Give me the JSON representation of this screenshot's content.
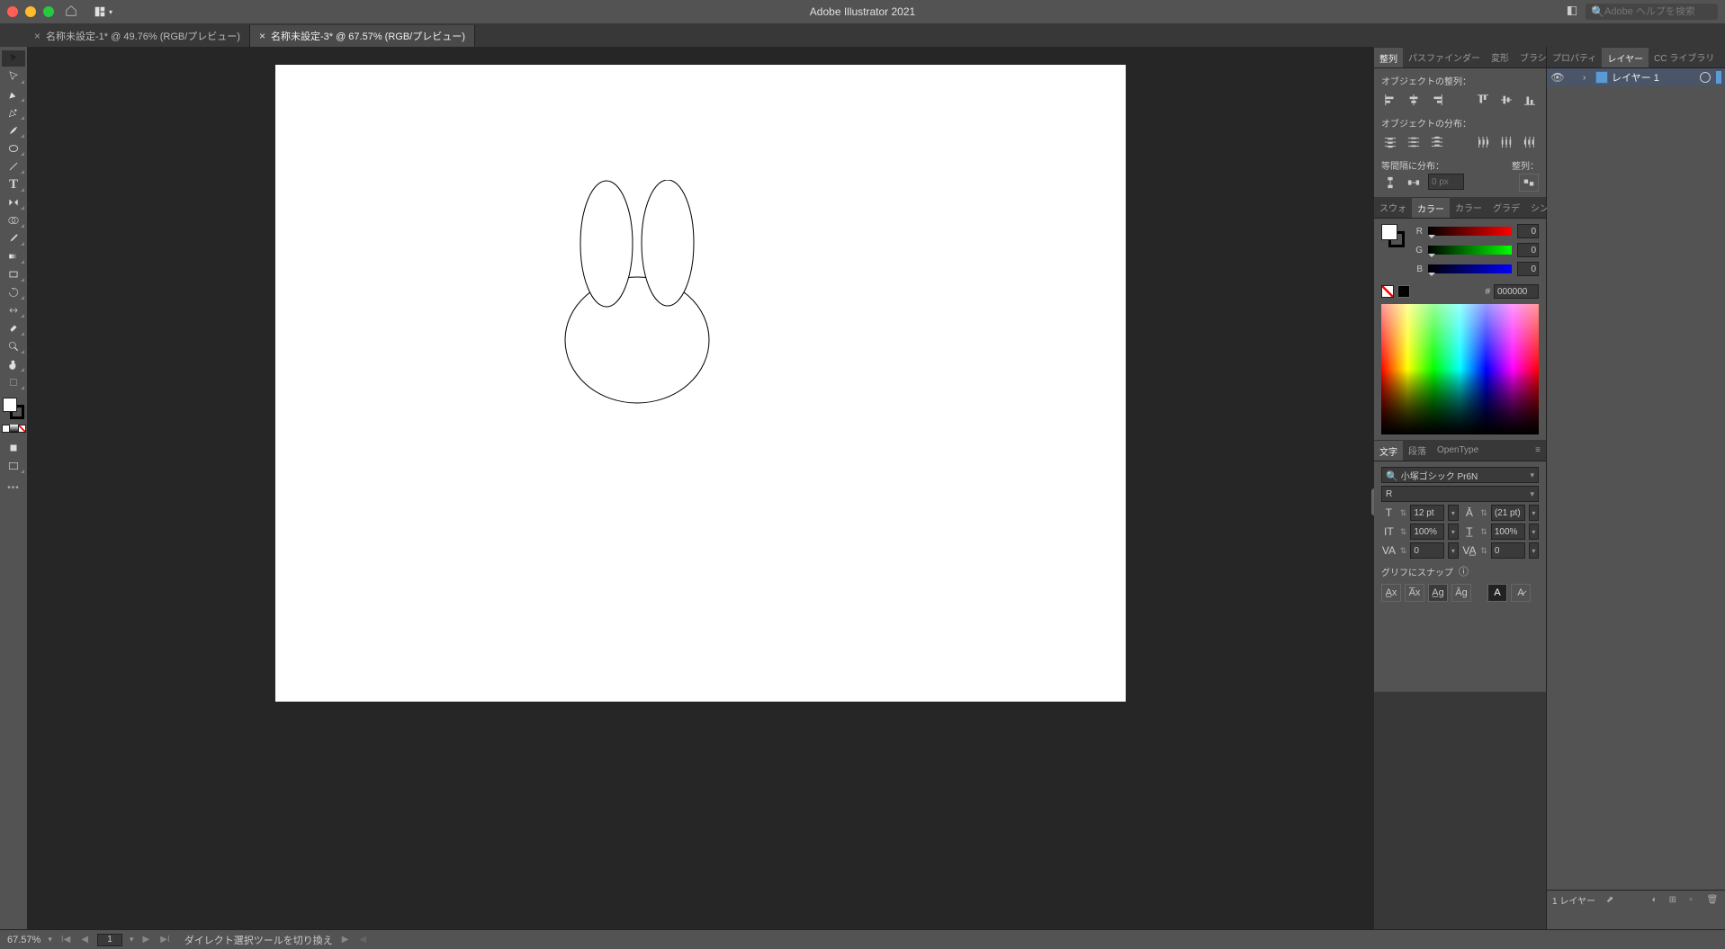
{
  "app": {
    "title": "Adobe Illustrator 2021",
    "search_placeholder": "Adobe ヘルプを検索"
  },
  "tabs": [
    {
      "label": "名称未設定-1* @ 49.76% (RGB/プレビュー)",
      "active": false
    },
    {
      "label": "名称未設定-3* @ 67.57% (RGB/プレビュー)",
      "active": true
    }
  ],
  "panel_groups": {
    "align": {
      "tabs": [
        "整列",
        "パスファインダー",
        "変形",
        "ブラシ"
      ],
      "active": 0
    },
    "color": {
      "tabs": [
        "スウォ",
        "カラー",
        "カラー",
        "グラデ",
        "シンボ"
      ],
      "active": 1
    },
    "char": {
      "tabs": [
        "文字",
        "段落",
        "OpenType"
      ],
      "active": 0
    },
    "props": {
      "tabs": [
        "プロパティ",
        "レイヤー",
        "CC ライブラリ"
      ],
      "active": 1
    }
  },
  "align_panel": {
    "label_align": "オブジェクトの整列：",
    "label_distribute": "オブジェクトの分布：",
    "label_spacing": "等間隔に分布：",
    "label_alignto": "整列：",
    "spacing_value": "0 px"
  },
  "color_panel": {
    "r_label": "R",
    "r_val": "0",
    "g_label": "G",
    "g_val": "0",
    "b_label": "B",
    "b_val": "0",
    "hex_label": "#",
    "hex_val": "000000"
  },
  "char_panel": {
    "font": "小塚ゴシック Pr6N",
    "style": "R",
    "size": "12 pt",
    "leading": "(21 pt)",
    "vscale": "100%",
    "hscale": "100%",
    "tracking": "0",
    "baseline": "0",
    "snap_label": "グリフにスナップ"
  },
  "layers_panel": {
    "layer1_name": "レイヤー 1",
    "footer_count": "1 レイヤー"
  },
  "status": {
    "zoom": "67.57%",
    "artboard_num": "1",
    "tool_hint": "ダイレクト選択ツールを切り換え"
  }
}
